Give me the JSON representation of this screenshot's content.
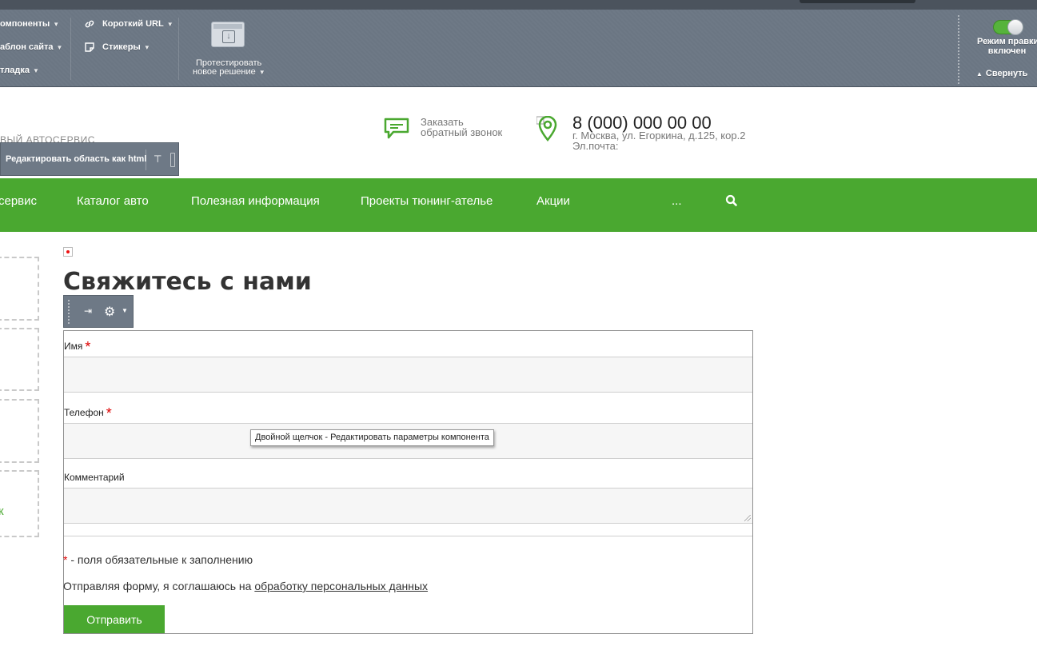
{
  "admin_panel": {
    "group1": [
      "омпоненты",
      "аблон сайта",
      "тладка"
    ],
    "short_url": "Короткий URL",
    "stickers": "Стикеры",
    "test_solution_line1": "Протестировать",
    "test_solution_line2": "новое решение",
    "edit_mode_line1": "Режим правки",
    "edit_mode_line2": "включен",
    "collapse": "Свернуть",
    "edit_mode_on": true
  },
  "header": {
    "brand_fragment": "ВЫЙ АВТОСЕРВИС",
    "html_edit": "Редактировать область как html",
    "callback_line1": "Заказать",
    "callback_line2": "обратный звонок",
    "phone": "8 (000) 000 00 00",
    "address": "г. Москва, ул. Егоркина, д.125, кор.2",
    "email_label": "Эл.почта:"
  },
  "menu": {
    "items": [
      "сервис",
      "Каталог авто",
      "Полезная информация",
      "Проекты тюнинг-ателье",
      "Акции",
      "..."
    ],
    "accent": "#4aa830"
  },
  "sidebar": {
    "fragment_text": "к"
  },
  "content": {
    "title": "Свяжитесь с нами",
    "form": {
      "name_label": "Имя",
      "phone_label": "Телефон",
      "comment_label": "Комментарий",
      "required_mark": "*",
      "required_note": " - поля обязательные к заполнению",
      "consent_prefix": "Отправляя форму, я соглашаюсь на ",
      "consent_link": "обработку персональных данных",
      "submit": "Отправить"
    },
    "tooltip": "Двойной щелчок - Редактировать параметры компонента"
  }
}
